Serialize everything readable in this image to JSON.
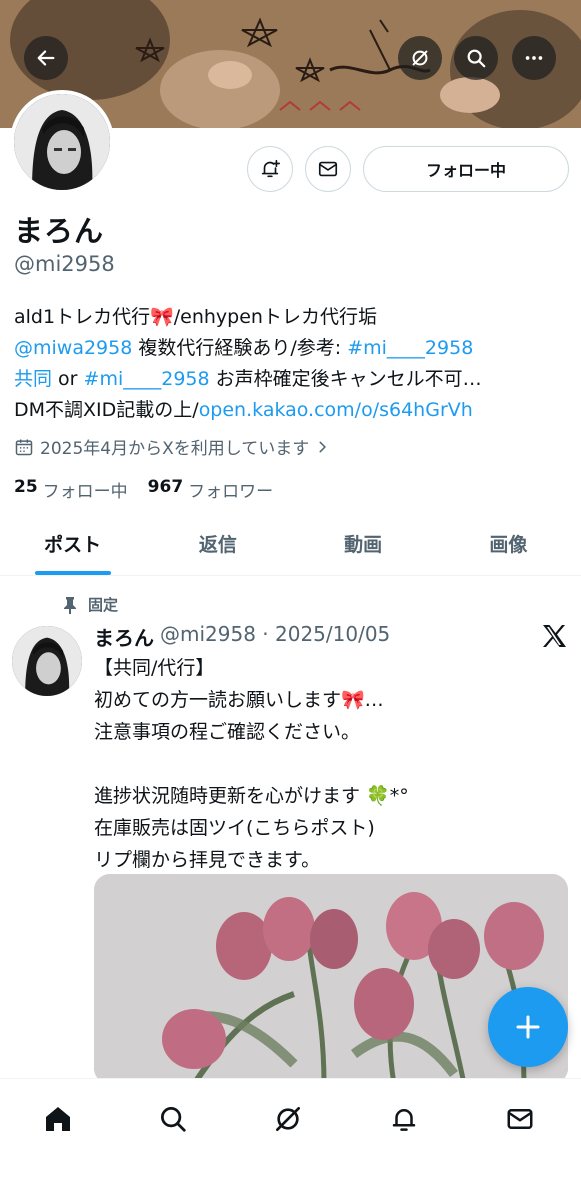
{
  "header": {
    "back_icon": "arrow-left-icon",
    "grok_icon": "grok-icon",
    "search_icon": "search-icon",
    "more_icon": "more-icon"
  },
  "profile": {
    "name": "まろん",
    "handle": "@mi2958",
    "follow_label": "フォロー中",
    "bio_lines": [
      [
        "ald1トレカ代行🎀/enhypenトレカ代行垢"
      ],
      [
        "@miwa2958",
        " 複数代行経験あり/参考: ",
        "#mi____2958"
      ],
      [
        "共同",
        " or ",
        "#mi____2958",
        " お声枠確定後キャンセル不可…"
      ],
      [
        "DM不調XID記載の上/",
        "open.kakao.com/o/s64hGrVh"
      ]
    ],
    "joined": "2025年4月からXを利用しています",
    "following_count": "25",
    "following_label": "フォロー中",
    "followers_count": "967",
    "followers_label": "フォロワー"
  },
  "tabs": [
    {
      "label": "ポスト",
      "active": true
    },
    {
      "label": "返信",
      "active": false
    },
    {
      "label": "動画",
      "active": false
    },
    {
      "label": "画像",
      "active": false
    }
  ],
  "post": {
    "pinned_label": "固定",
    "author_name": "まろん",
    "meta": "@mi2958 · 2025/10/05",
    "lines": [
      "【共同/代行】",
      "初めての方一読お願いします🎀…",
      "注意事項の程ご確認ください。",
      "",
      "進捗状況随時更新を心がけます 🍀*°",
      "在庫販売は固ツイ(こちらポスト)",
      "リプ欄から拝見できます。"
    ]
  },
  "colors": {
    "accent": "#1d9bf0",
    "text": "#0f1419",
    "muted": "#536471",
    "border": "#cfd9de"
  },
  "nav": [
    "home-icon",
    "search-icon",
    "grok-icon",
    "bell-icon",
    "mail-icon"
  ]
}
